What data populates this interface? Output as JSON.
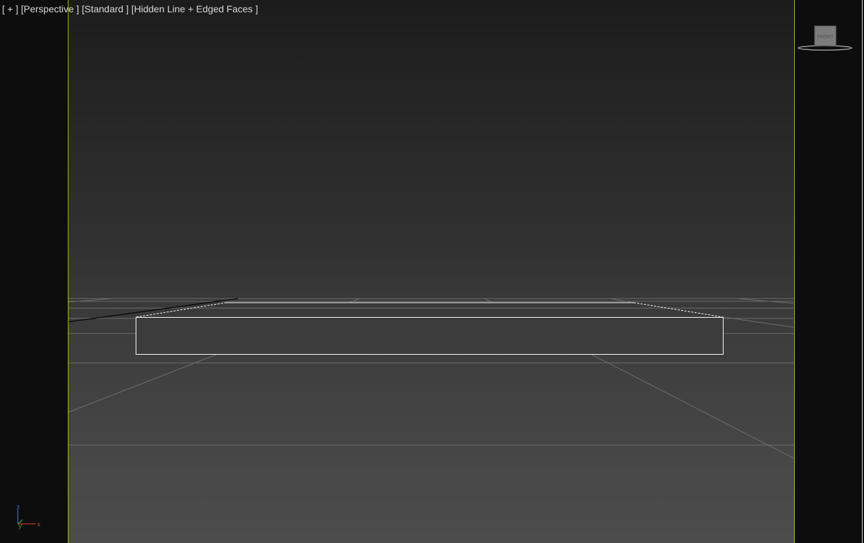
{
  "viewport": {
    "label": {
      "plus": "[ + ]",
      "view": "[Perspective ]",
      "shading": "[Standard ]",
      "style": "[Hidden Line + Edged Faces ]"
    },
    "border_color": "#b6ad2a"
  },
  "viewcube": {
    "face_label": "FRONT",
    "icon": "viewcube-icon"
  },
  "axis_tripod": {
    "x": "x",
    "y": "y",
    "z": "z",
    "colors": {
      "x": "#c0392b",
      "y": "#2e9e3e",
      "z": "#3b6fd6"
    }
  }
}
